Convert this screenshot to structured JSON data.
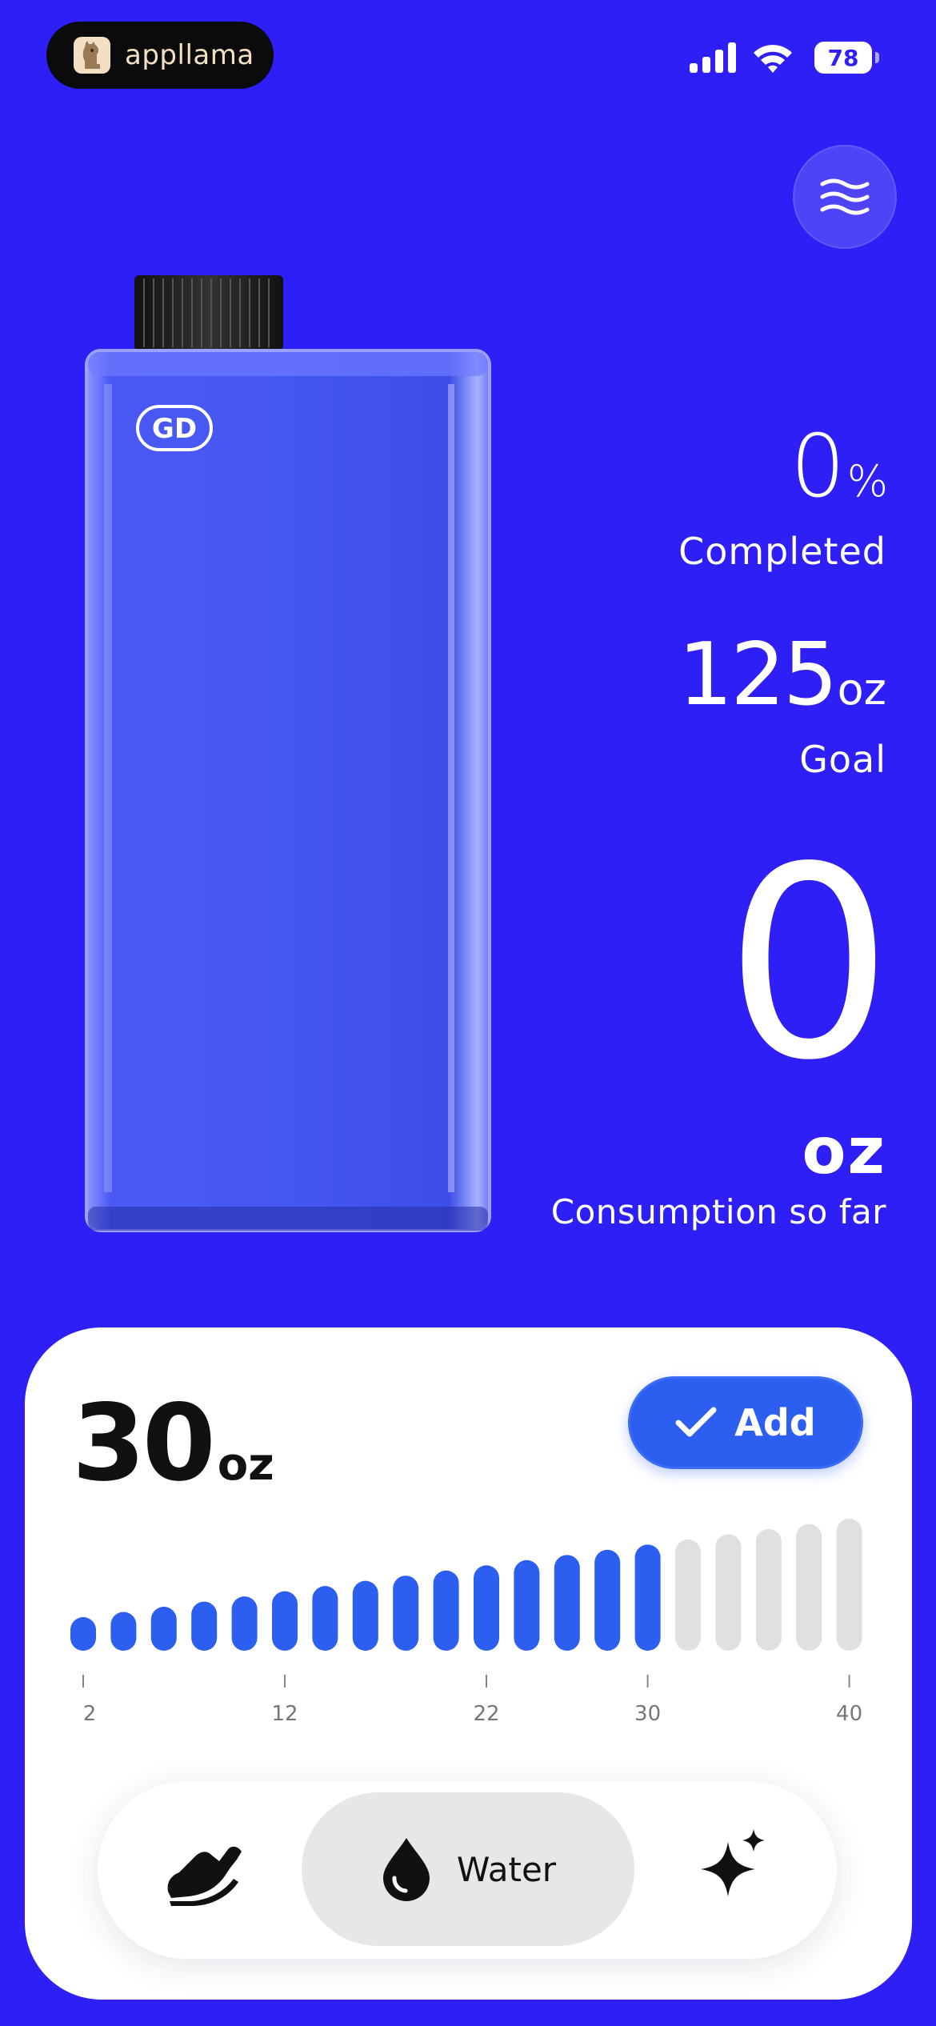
{
  "status_bar": {
    "brand": "appllama",
    "battery": "78"
  },
  "bottle": {
    "badge": "GD"
  },
  "stats": {
    "completed_value": "0",
    "completed_unit": "%",
    "completed_label": "Completed",
    "goal_value": "125",
    "goal_unit": "oz",
    "goal_label": "Goal",
    "consumption_value": "0",
    "consumption_unit": "oz",
    "consumption_label": "Consumption so far"
  },
  "card": {
    "amount_value": "30",
    "amount_unit": "oz",
    "add_label": "Add",
    "slider": {
      "bar_count": 20,
      "selected_count": 15,
      "tick_labels": [
        "2",
        "12",
        "22",
        "30",
        "40"
      ],
      "active_color": "#2c5ef0",
      "inactive_color": "#e0e0e0"
    },
    "tabs": [
      {
        "icon": "shoe-icon",
        "label": ""
      },
      {
        "icon": "water-drop-icon",
        "label": "Water"
      },
      {
        "icon": "sparkle-icon",
        "label": ""
      }
    ]
  },
  "colors": {
    "background": "#2d1ff5",
    "accent": "#2c5ef0"
  }
}
